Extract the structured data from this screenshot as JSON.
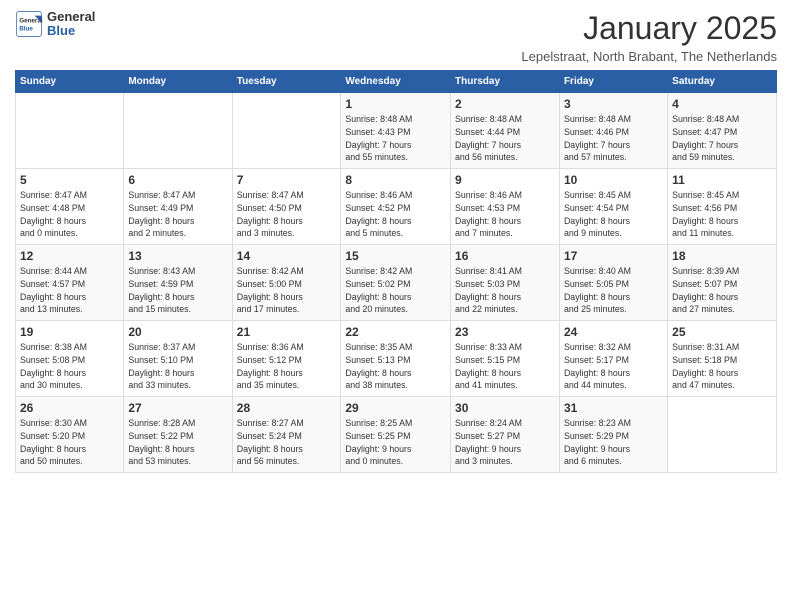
{
  "logo": {
    "general": "General",
    "blue": "Blue"
  },
  "title": "January 2025",
  "location": "Lepelstraat, North Brabant, The Netherlands",
  "days_header": [
    "Sunday",
    "Monday",
    "Tuesday",
    "Wednesday",
    "Thursday",
    "Friday",
    "Saturday"
  ],
  "weeks": [
    [
      {
        "day": "",
        "info": ""
      },
      {
        "day": "",
        "info": ""
      },
      {
        "day": "",
        "info": ""
      },
      {
        "day": "1",
        "info": "Sunrise: 8:48 AM\nSunset: 4:43 PM\nDaylight: 7 hours\nand 55 minutes."
      },
      {
        "day": "2",
        "info": "Sunrise: 8:48 AM\nSunset: 4:44 PM\nDaylight: 7 hours\nand 56 minutes."
      },
      {
        "day": "3",
        "info": "Sunrise: 8:48 AM\nSunset: 4:46 PM\nDaylight: 7 hours\nand 57 minutes."
      },
      {
        "day": "4",
        "info": "Sunrise: 8:48 AM\nSunset: 4:47 PM\nDaylight: 7 hours\nand 59 minutes."
      }
    ],
    [
      {
        "day": "5",
        "info": "Sunrise: 8:47 AM\nSunset: 4:48 PM\nDaylight: 8 hours\nand 0 minutes."
      },
      {
        "day": "6",
        "info": "Sunrise: 8:47 AM\nSunset: 4:49 PM\nDaylight: 8 hours\nand 2 minutes."
      },
      {
        "day": "7",
        "info": "Sunrise: 8:47 AM\nSunset: 4:50 PM\nDaylight: 8 hours\nand 3 minutes."
      },
      {
        "day": "8",
        "info": "Sunrise: 8:46 AM\nSunset: 4:52 PM\nDaylight: 8 hours\nand 5 minutes."
      },
      {
        "day": "9",
        "info": "Sunrise: 8:46 AM\nSunset: 4:53 PM\nDaylight: 8 hours\nand 7 minutes."
      },
      {
        "day": "10",
        "info": "Sunrise: 8:45 AM\nSunset: 4:54 PM\nDaylight: 8 hours\nand 9 minutes."
      },
      {
        "day": "11",
        "info": "Sunrise: 8:45 AM\nSunset: 4:56 PM\nDaylight: 8 hours\nand 11 minutes."
      }
    ],
    [
      {
        "day": "12",
        "info": "Sunrise: 8:44 AM\nSunset: 4:57 PM\nDaylight: 8 hours\nand 13 minutes."
      },
      {
        "day": "13",
        "info": "Sunrise: 8:43 AM\nSunset: 4:59 PM\nDaylight: 8 hours\nand 15 minutes."
      },
      {
        "day": "14",
        "info": "Sunrise: 8:42 AM\nSunset: 5:00 PM\nDaylight: 8 hours\nand 17 minutes."
      },
      {
        "day": "15",
        "info": "Sunrise: 8:42 AM\nSunset: 5:02 PM\nDaylight: 8 hours\nand 20 minutes."
      },
      {
        "day": "16",
        "info": "Sunrise: 8:41 AM\nSunset: 5:03 PM\nDaylight: 8 hours\nand 22 minutes."
      },
      {
        "day": "17",
        "info": "Sunrise: 8:40 AM\nSunset: 5:05 PM\nDaylight: 8 hours\nand 25 minutes."
      },
      {
        "day": "18",
        "info": "Sunrise: 8:39 AM\nSunset: 5:07 PM\nDaylight: 8 hours\nand 27 minutes."
      }
    ],
    [
      {
        "day": "19",
        "info": "Sunrise: 8:38 AM\nSunset: 5:08 PM\nDaylight: 8 hours\nand 30 minutes."
      },
      {
        "day": "20",
        "info": "Sunrise: 8:37 AM\nSunset: 5:10 PM\nDaylight: 8 hours\nand 33 minutes."
      },
      {
        "day": "21",
        "info": "Sunrise: 8:36 AM\nSunset: 5:12 PM\nDaylight: 8 hours\nand 35 minutes."
      },
      {
        "day": "22",
        "info": "Sunrise: 8:35 AM\nSunset: 5:13 PM\nDaylight: 8 hours\nand 38 minutes."
      },
      {
        "day": "23",
        "info": "Sunrise: 8:33 AM\nSunset: 5:15 PM\nDaylight: 8 hours\nand 41 minutes."
      },
      {
        "day": "24",
        "info": "Sunrise: 8:32 AM\nSunset: 5:17 PM\nDaylight: 8 hours\nand 44 minutes."
      },
      {
        "day": "25",
        "info": "Sunrise: 8:31 AM\nSunset: 5:18 PM\nDaylight: 8 hours\nand 47 minutes."
      }
    ],
    [
      {
        "day": "26",
        "info": "Sunrise: 8:30 AM\nSunset: 5:20 PM\nDaylight: 8 hours\nand 50 minutes."
      },
      {
        "day": "27",
        "info": "Sunrise: 8:28 AM\nSunset: 5:22 PM\nDaylight: 8 hours\nand 53 minutes."
      },
      {
        "day": "28",
        "info": "Sunrise: 8:27 AM\nSunset: 5:24 PM\nDaylight: 8 hours\nand 56 minutes."
      },
      {
        "day": "29",
        "info": "Sunrise: 8:25 AM\nSunset: 5:25 PM\nDaylight: 9 hours\nand 0 minutes."
      },
      {
        "day": "30",
        "info": "Sunrise: 8:24 AM\nSunset: 5:27 PM\nDaylight: 9 hours\nand 3 minutes."
      },
      {
        "day": "31",
        "info": "Sunrise: 8:23 AM\nSunset: 5:29 PM\nDaylight: 9 hours\nand 6 minutes."
      },
      {
        "day": "",
        "info": ""
      }
    ]
  ]
}
